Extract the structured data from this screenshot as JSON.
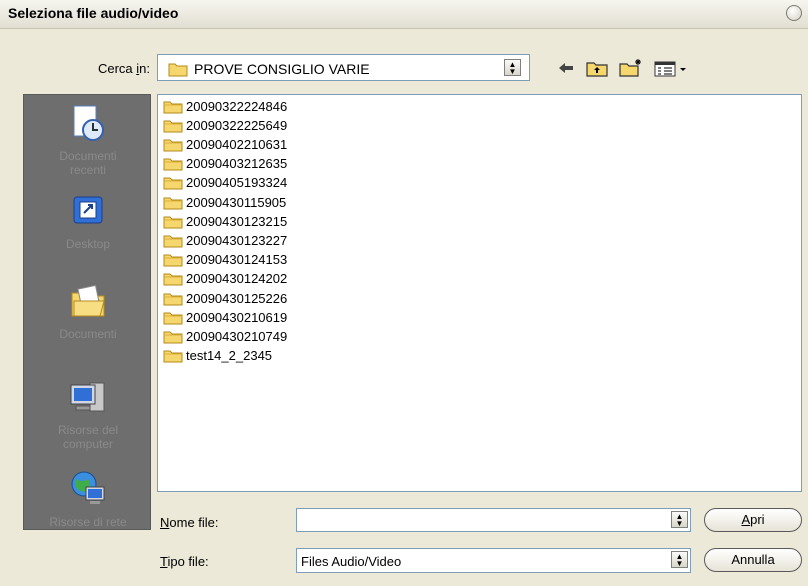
{
  "window": {
    "title": "Seleziona file audio/video"
  },
  "lookin": {
    "label_pre": "Cerca ",
    "label_key": "i",
    "label_post": "n:",
    "value": "PROVE CONSIGLIO VARIE"
  },
  "toolbar": {
    "back": "back-arrow-icon",
    "up": "folder-up-icon",
    "new_folder": "new-folder-icon",
    "view_menu": "view-menu-icon"
  },
  "places": [
    {
      "line1": "Documenti",
      "line2": "recenti",
      "icon": "recent-documents-icon"
    },
    {
      "line1": "Desktop",
      "line2": "",
      "icon": "desktop-icon"
    },
    {
      "line1": "Documenti",
      "line2": "",
      "icon": "documents-icon"
    },
    {
      "line1": "Risorse del",
      "line2": "computer",
      "icon": "my-computer-icon"
    },
    {
      "line1": "Risorse di rete",
      "line2": "",
      "icon": "network-icon"
    }
  ],
  "files": [
    "20090322224846",
    "20090322225649",
    "20090402210631",
    "20090403212635",
    "20090405193324",
    "20090430115905",
    "20090430123215",
    "20090430123227",
    "20090430124153",
    "20090430124202",
    "20090430125226",
    "20090430210619",
    "20090430210749",
    "test14_2_2345"
  ],
  "filename": {
    "label_key": "N",
    "label_rest": "ome file:",
    "value": ""
  },
  "filetype": {
    "label_key": "T",
    "label_rest": "ipo file:",
    "value": "Files Audio/Video"
  },
  "buttons": {
    "open_key": "A",
    "open_rest": "pri",
    "cancel": "Annulla"
  },
  "colors": {
    "folder": "#f5d76e",
    "places_bg": "#6e6e6e",
    "dialog_bg": "#ece9d8"
  }
}
